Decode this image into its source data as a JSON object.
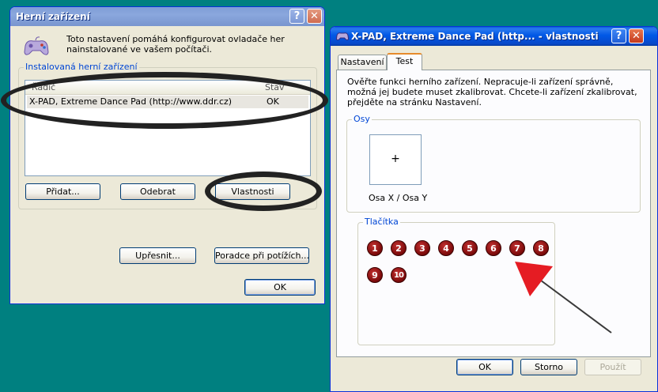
{
  "game_controllers": {
    "title": "Herní zařízení",
    "description": "Toto nastavení pomáhá konfigurovat ovladače her nainstalované ve vašem počítači.",
    "installed_group_label": "Instalovaná herní zařízení",
    "list_headers": {
      "controller": "Řadič",
      "status": "Stav"
    },
    "devices": [
      {
        "name": "X-PAD, Extreme Dance Pad (http://www.ddr.cz)",
        "status": "OK"
      }
    ],
    "buttons": {
      "add": "Přidat...",
      "remove": "Odebrat",
      "properties": "Vlastnosti",
      "advanced": "Upřesnit...",
      "troubleshoot": "Poradce při potížích...",
      "ok": "OK"
    }
  },
  "properties_dialog": {
    "title": "X-PAD, Extreme Dance Pad (http... - vlastnosti",
    "tabs": [
      "Nastavení",
      "Test"
    ],
    "active_tab": "Test",
    "instructions": "Ověřte funkci herního zařízení. Nepracuje-li zařízení správně, možná jej budete muset zkalibrovat. Chcete-li zařízení zkalibrovat, přejděte na stránku Nastavení.",
    "axes_group_label": "Osy",
    "axes_cursor": "+",
    "axes_caption": "Osa X / Osa Y",
    "buttons_group_label": "Tlačítka",
    "button_numbers": [
      "1",
      "2",
      "3",
      "4",
      "5",
      "6",
      "7",
      "8",
      "9",
      "10"
    ],
    "footer_buttons": {
      "ok": "OK",
      "cancel": "Storno",
      "apply": "Použít"
    }
  },
  "window_controls": {
    "help": "?",
    "close": "✕"
  },
  "colors": {
    "desktop": "#008080",
    "highlight_ring": "#222222",
    "arrow": "#e51c23",
    "joystick_button": "#7a0a0a"
  },
  "icons": [
    "gamepad-icon",
    "help-icon",
    "close-icon",
    "annotation-arrow-icon"
  ]
}
